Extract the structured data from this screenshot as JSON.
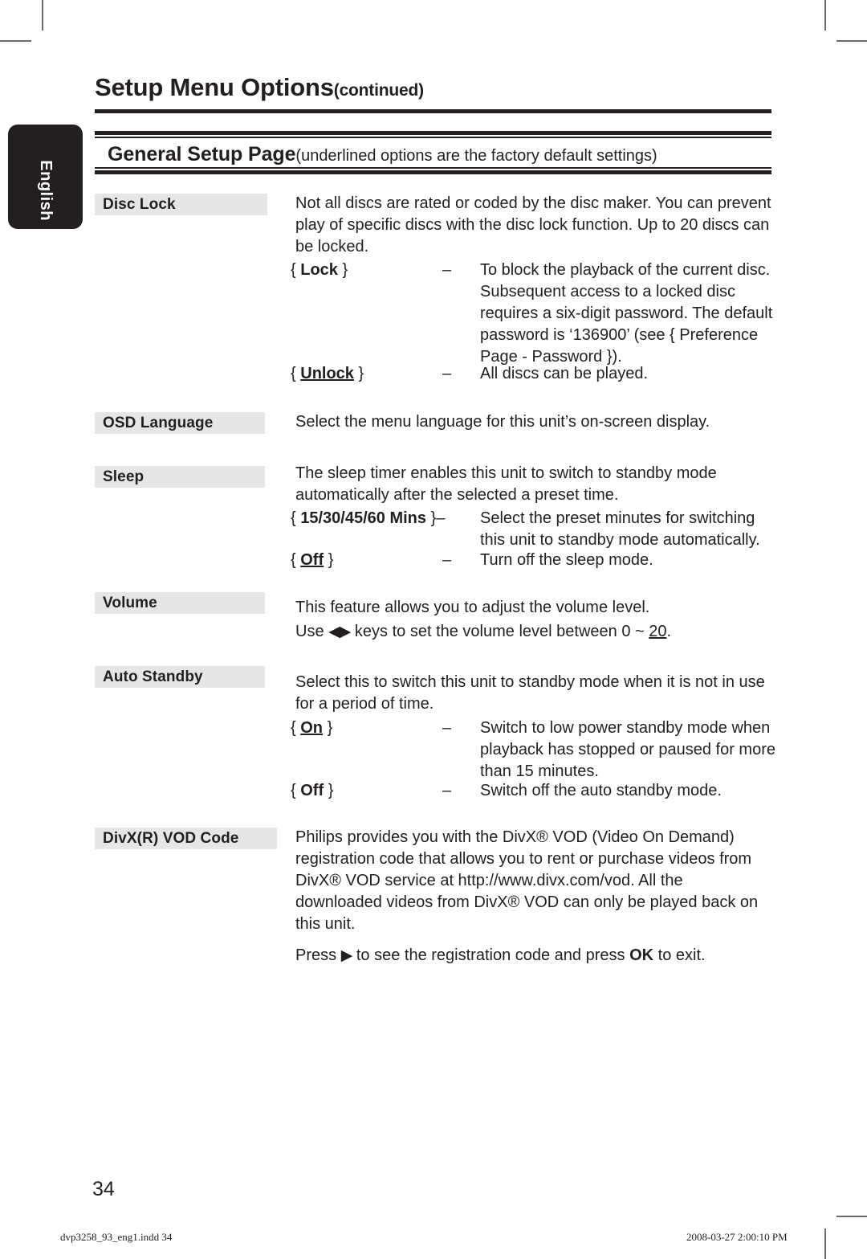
{
  "document": {
    "title": "Setup Menu Options",
    "title_suffix": "(continued)",
    "language_tab": "English",
    "section_title": "General Setup Page",
    "section_note": "(underlined options are the factory default settings)",
    "page_number": "34",
    "footer_file": "dvp3258_93_eng1.indd   34",
    "footer_timestamp": "2008-03-27   2:00:10 PM"
  },
  "entries": [
    {
      "label": "Disc Lock",
      "intro": "Not all discs are rated or coded by the disc maker. You can prevent play of specific discs with the disc lock function. Up to 20 discs can be locked.",
      "options": [
        {
          "name_prefix": "{ ",
          "name": "Lock",
          "name_suffix": " }",
          "bold": true,
          "underline": false,
          "dash": "–",
          "desc": "To block the playback of the current disc. Subsequent access to a locked disc requires a six-digit password. The default password is ‘136900’ (see { Preference Page - Password })."
        },
        {
          "name_prefix": "{ ",
          "name": "Unlock",
          "name_suffix": " }",
          "bold": true,
          "underline": true,
          "dash": "–",
          "desc": "All discs can be played."
        }
      ]
    },
    {
      "label": "OSD Language",
      "intro": "Select the menu language for this unit’s on-screen display.",
      "options": []
    },
    {
      "label": "Sleep",
      "intro": "The sleep timer enables this unit to switch to standby mode automatically after the selected a preset time.",
      "options": [
        {
          "name_prefix": "{ ",
          "name": "15/30/45/60 Mins",
          "name_suffix": " }–",
          "bold": true,
          "underline": false,
          "dash": "",
          "desc": "Select the preset minutes for switching this unit to standby mode automatically."
        },
        {
          "name_prefix": "{ ",
          "name": "Off",
          "name_suffix": " }",
          "bold": true,
          "underline": true,
          "dash": "–",
          "desc": "Turn off the sleep mode."
        }
      ]
    },
    {
      "label": "Volume",
      "intro": "This feature allows you to adjust the volume level.",
      "intro_line2_pre": "Use ",
      "intro_line2_keys": "◀▶",
      "intro_line2_mid": " keys to set the volume level between 0 ~ ",
      "intro_line2_default": "20",
      "intro_line2_post": ".",
      "options": []
    },
    {
      "label": "Auto Standby",
      "intro": "Select this to switch this unit to standby mode when it is not in use for a period of time.",
      "options": [
        {
          "name_prefix": "{ ",
          "name": "On",
          "name_suffix": " }",
          "bold": true,
          "underline": true,
          "dash": "–",
          "desc": "Switch to low power standby mode when playback has stopped or paused for more than 15 minutes."
        },
        {
          "name_prefix": "{ ",
          "name": "Off",
          "name_suffix": " }",
          "bold": true,
          "underline": false,
          "dash": "–",
          "desc": "Switch off the auto standby mode."
        }
      ]
    },
    {
      "label": "DivX(R) VOD Code",
      "intro": "Philips provides you with the DivX® VOD (Video On Demand) registration code that allows you to rent or purchase videos from DivX® VOD service at http://www.divx.com/vod. All the downloaded videos from DivX® VOD can only be played back on this unit.",
      "press_pre": "Press ",
      "press_arrow": "▶",
      "press_mid": " to see the registration code and press ",
      "press_key": "OK",
      "press_post": " to exit.",
      "options": []
    }
  ]
}
